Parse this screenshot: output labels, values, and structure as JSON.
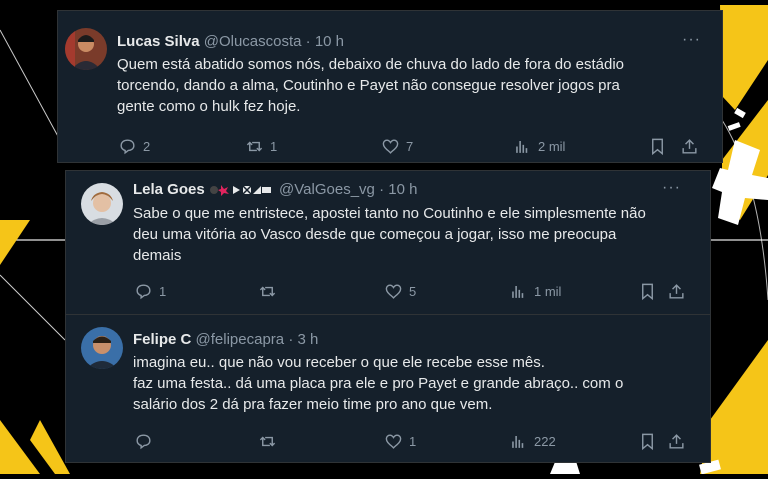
{
  "tweets": [
    {
      "name": "Lucas Silva",
      "handle": "@Olucascosta",
      "time": "· 10 h",
      "text": "Quem está abatido somos nós, debaixo de chuva do lado de fora do estádio\ntorcendo, dando a alma, Coutinho e Payet não consegue resolver jogos pra\ngente como o hulk fez hoje.",
      "replies": "2",
      "retweets": "1",
      "likes": "7",
      "views": "2 mil"
    },
    {
      "name": "Lela Goes",
      "handle": "@ValGoes_vg",
      "time": "· 10 h",
      "text": "Sabe o que me entristece, apostei tanto no Coutinho e ele simplesmente não\ndeu uma vitória ao Vasco desde que começou a jogar, isso me preocupa\ndemais",
      "replies": "1",
      "retweets": "",
      "likes": "5",
      "views": "1 mil"
    },
    {
      "name": "Felipe C",
      "handle": "@felipecapra",
      "time": "· 3 h",
      "text": "imagina eu.. que não vou receber o que ele recebe esse mês.\nfaz uma festa.. dá uma placa pra ele e pro Payet e grande abraço.. com o\nsalário dos 2 dá pra fazer meio time pro ano que vem.",
      "replies": "",
      "retweets": "",
      "likes": "1",
      "views": "222"
    }
  ],
  "icons": {
    "reply": "reply-icon",
    "retweet": "retweet-icon",
    "like": "heart-icon",
    "views": "views-icon",
    "bookmark": "bookmark-icon",
    "share": "share-icon",
    "more": "more-icon"
  },
  "more_label": "···",
  "colors": {
    "card_bg": "#15202b",
    "muted": "#8b98a5",
    "text": "#e7e9ea",
    "accent_yellow": "#f5c518"
  }
}
